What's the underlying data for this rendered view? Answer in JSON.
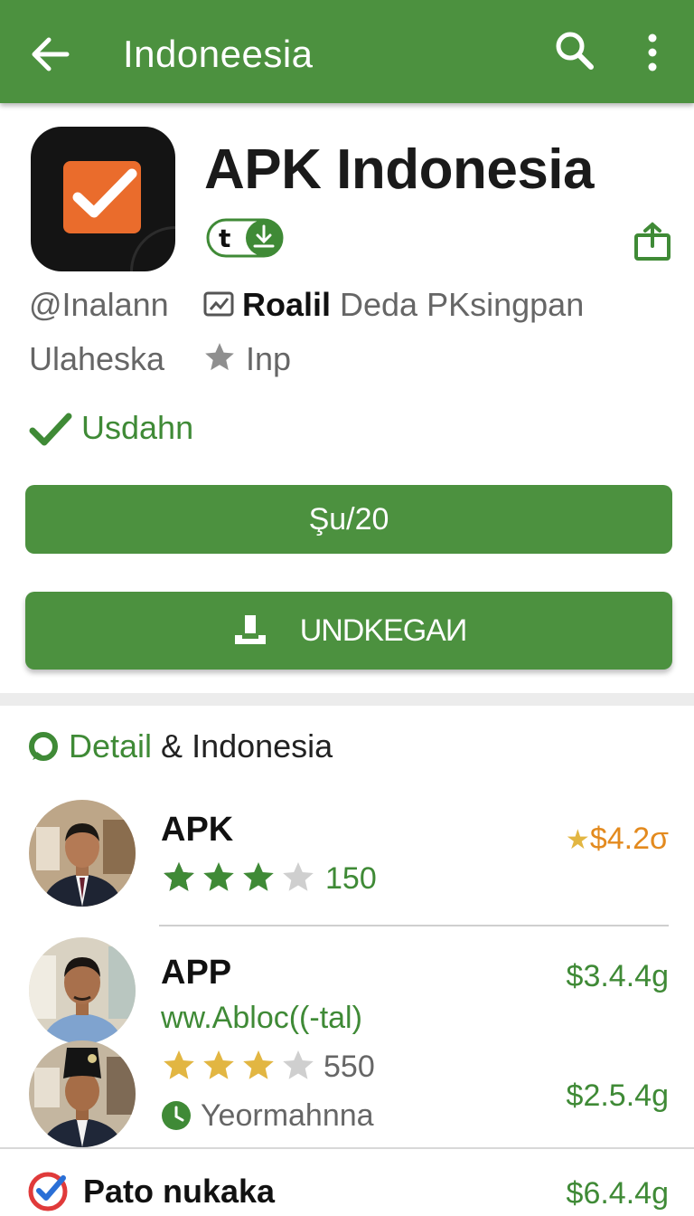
{
  "appbar": {
    "title": "Indoneesia",
    "color": "#4c913f"
  },
  "app": {
    "name": "APK Indonesia",
    "developer": "@Inalann",
    "release_bold": "Roalil",
    "release_rest": " Deda PKsingpan",
    "category": "Ulaheska",
    "rating_label": "Inp",
    "status": "Usdahn"
  },
  "buttons": {
    "price": "Şu/20",
    "install": "UNDKEGAИ"
  },
  "section": {
    "accent": "Detail",
    "rest": " & Indonesia"
  },
  "items": [
    {
      "title": "APK",
      "stars": 3,
      "count": "150",
      "price": "$4.2σ",
      "price_star": "★"
    },
    {
      "title": "APP",
      "subtitle": "ww.Abloc((-tal)",
      "price": "$3.4.4g"
    },
    {
      "stars": 3,
      "count": "550",
      "status": "Yeormahnna",
      "price": "$2.5.4g"
    },
    {
      "title": "Pato nukaka",
      "price": "$6.4.4g"
    }
  ],
  "colors": {
    "accent_green": "#3f8a36",
    "star_gold": "#e2b642",
    "price_orange": "#e38a1e"
  }
}
